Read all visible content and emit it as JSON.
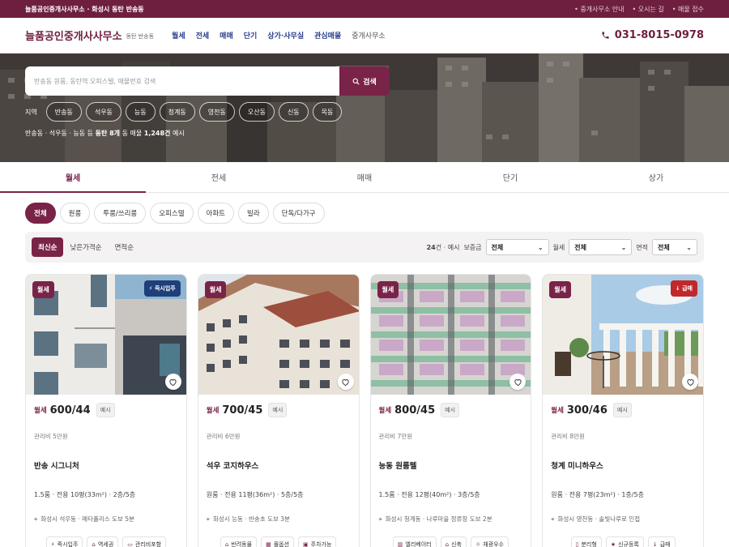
{
  "topbar": {
    "site": "늘품공인중개사사무소 · 화성시 동탄 반송동",
    "links": [
      "중개사무소 안내",
      "오시는 길",
      "매물 접수"
    ]
  },
  "header": {
    "brand": "늘품공인중개사사무소",
    "brand_sub": "동탄 반송동",
    "nav": [
      "월세",
      "전세",
      "매매",
      "단기",
      "상가·사무실",
      "관심매물"
    ],
    "nav_muted": "중개사무소",
    "phone": "031-8015-0978"
  },
  "hero": {
    "search_placeholder": "반송동 원룸, 동탄역 오피스텔, 매물번호 검색",
    "search_button": "검색",
    "region_label": "지역",
    "regions": [
      "반송동",
      "석우동",
      "능동",
      "청계동",
      "영천동",
      "오산동",
      "신동",
      "목동"
    ],
    "note_pre": "반송동 · 석우동 · 능동 등 ",
    "note_bold1": "동탄 8개",
    "note_mid": " 동 매물 ",
    "note_bold2": "1,248건",
    "note_post": " 예시"
  },
  "tabs": [
    "월세",
    "전세",
    "매매",
    "단기",
    "상가"
  ],
  "types": [
    "전체",
    "원룸",
    "투룸/쓰리룸",
    "오피스텔",
    "아파트",
    "빌라",
    "단독/다가구"
  ],
  "filters": {
    "sorts": [
      "최신순",
      "낮은가격순",
      "면적순"
    ],
    "count_num": "24",
    "count_suffix": "건 · 예시",
    "deposit_label": "보증금",
    "deposit_value": "전체",
    "rent_label": "월세",
    "rent_value": "전체",
    "area_label": "면적",
    "area_value": "전체"
  },
  "listings": [
    {
      "badge": "월세",
      "flag": "즉시입주",
      "flag_color": "#1f3f7a",
      "kind": "월세",
      "amount": "600/44",
      "example": "예시",
      "fee": "관리비 5만원",
      "title": "반송 시그니처",
      "spec": "1.5룸 · 전용 10평(33m²) · 2층/5층",
      "location": "화성시 석우동 · 메타폴리스 도보 5분",
      "tags": [
        {
          "icon": "⚡",
          "label": "즉시입주"
        },
        {
          "icon": "⌂",
          "label": "역세권"
        },
        {
          "icon": "▭",
          "label": "관리비포함"
        }
      ]
    },
    {
      "badge": "월세",
      "flag": "",
      "flag_color": "",
      "kind": "월세",
      "amount": "700/45",
      "example": "예시",
      "fee": "관리비 6만원",
      "title": "석우 코지하우스",
      "spec": "원룸 · 전용 11평(36m²) · 5층/5층",
      "location": "화성시 능동 · 반송초 도보 3분",
      "tags": [
        {
          "icon": "⌂",
          "label": "반려동물"
        },
        {
          "icon": "▦",
          "label": "풀옵션"
        },
        {
          "icon": "▣",
          "label": "주차가능"
        }
      ]
    },
    {
      "badge": "월세",
      "flag": "",
      "flag_color": "",
      "kind": "월세",
      "amount": "800/45",
      "example": "예시",
      "fee": "관리비 7만원",
      "title": "능동 원룸텔",
      "spec": "1.5룸 · 전용 12평(40m²) · 3층/5층",
      "location": "화성시 청계동 · 나루마을 정류장 도보 2분",
      "tags": [
        {
          "icon": "▥",
          "label": "엘리베이터"
        },
        {
          "icon": "⌂",
          "label": "신축"
        },
        {
          "icon": "☼",
          "label": "채광우수"
        }
      ]
    },
    {
      "badge": "월세",
      "flag": "급매",
      "flag_color": "#c0282b",
      "kind": "월세",
      "amount": "300/46",
      "example": "예시",
      "fee": "관리비 8만원",
      "title": "청계 미니하우스",
      "spec": "원룸 · 전용 7평(23m²) · 1층/5층",
      "location": "화성시 영천동 · 솔빛나루로 인접",
      "tags": [
        {
          "icon": "▯",
          "label": "분리형"
        },
        {
          "icon": "★",
          "label": "신규등록"
        },
        {
          "icon": "↓",
          "label": "급매"
        }
      ]
    }
  ]
}
